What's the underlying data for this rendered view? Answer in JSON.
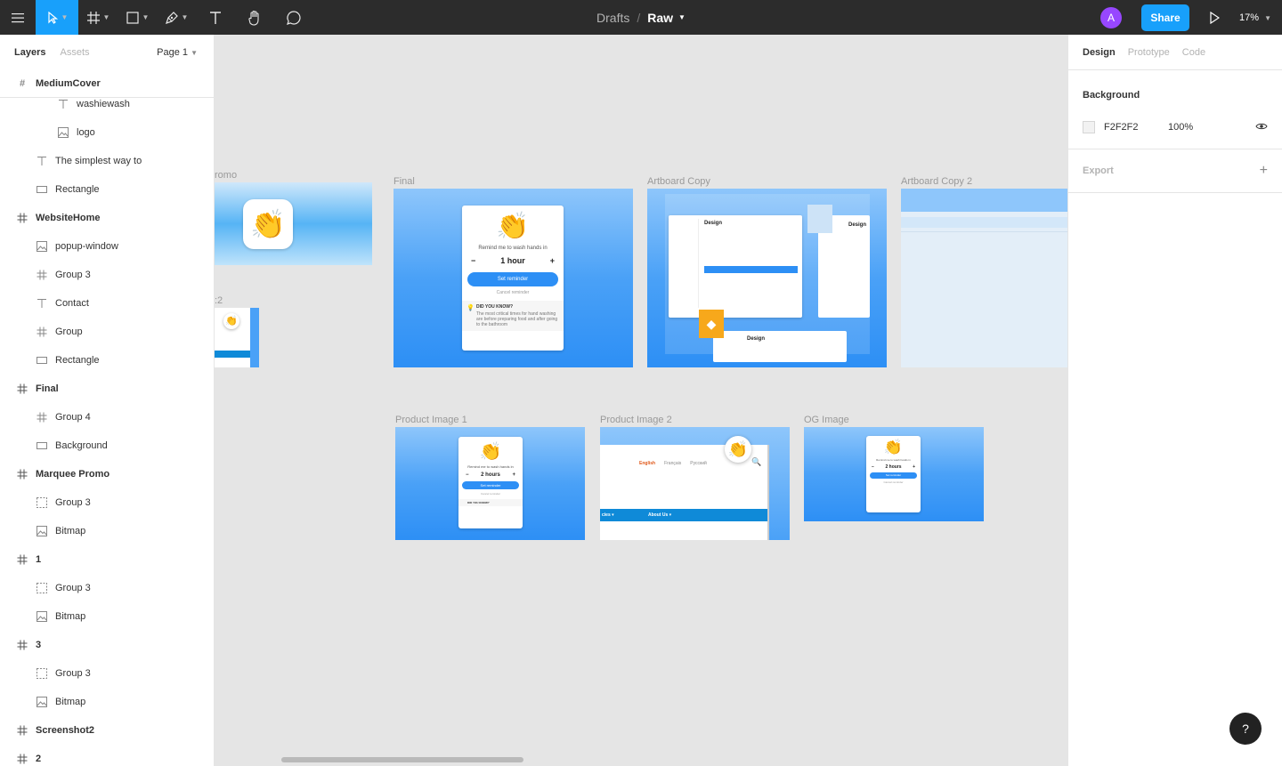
{
  "toolbar": {
    "file_parent": "Drafts",
    "file_name": "Raw",
    "avatar_initial": "A",
    "share_label": "Share",
    "zoom": "17%"
  },
  "left_panel": {
    "tab_layers": "Layers",
    "tab_assets": "Assets",
    "page": "Page 1",
    "sticky_frame": "MediumCover",
    "layers": [
      {
        "name": "washiewash",
        "type": "text",
        "level": "sub"
      },
      {
        "name": "logo",
        "type": "image",
        "level": "sub"
      },
      {
        "name": "The simplest way to",
        "type": "text",
        "level": "child"
      },
      {
        "name": "Rectangle",
        "type": "rect",
        "level": "child"
      },
      {
        "name": "WebsiteHome",
        "type": "frame",
        "level": "frame"
      },
      {
        "name": "popup-window",
        "type": "image",
        "level": "child"
      },
      {
        "name": "Group 3",
        "type": "frame",
        "level": "child"
      },
      {
        "name": "Contact",
        "type": "text",
        "level": "child"
      },
      {
        "name": "Group",
        "type": "frame",
        "level": "child"
      },
      {
        "name": "Rectangle",
        "type": "rect",
        "level": "child"
      },
      {
        "name": "Final",
        "type": "frame",
        "level": "frame"
      },
      {
        "name": "Group 4",
        "type": "frame",
        "level": "child"
      },
      {
        "name": "Background",
        "type": "rect",
        "level": "child"
      },
      {
        "name": "Marquee Promo",
        "type": "frame",
        "level": "frame"
      },
      {
        "name": "Group 3",
        "type": "group",
        "level": "child"
      },
      {
        "name": "Bitmap",
        "type": "image",
        "level": "child"
      },
      {
        "name": "1",
        "type": "frame",
        "level": "frame"
      },
      {
        "name": "Group 3",
        "type": "group",
        "level": "child"
      },
      {
        "name": "Bitmap",
        "type": "image",
        "level": "child"
      },
      {
        "name": "3",
        "type": "frame",
        "level": "frame"
      },
      {
        "name": "Group 3",
        "type": "group",
        "level": "child"
      },
      {
        "name": "Bitmap",
        "type": "image",
        "level": "child"
      },
      {
        "name": "Screenshot2",
        "type": "frame",
        "level": "frame"
      },
      {
        "name": "2",
        "type": "frame",
        "level": "frame"
      }
    ]
  },
  "canvas": {
    "labels": {
      "promo": "romo",
      "final": "Final",
      "artboard_copy": "Artboard Copy",
      "artboard_copy_2": "Artboard Copy 2",
      "partial_2": ":2",
      "product_image_1": "Product Image 1",
      "product_image_2": "Product Image 2",
      "og_image": "OG Image"
    },
    "card": {
      "emoji": "👏",
      "remind": "Remind me to wash hands in",
      "minus": "−",
      "plus": "+",
      "duration_final": "1 hour",
      "duration_product": "2 hours",
      "set_reminder": "Set reminder",
      "cancel": "Cancel reminder",
      "know_title": "DID YOU KNOW?",
      "know_body": "The most critical times for hand washing are before preparing food and after going to the bathroom"
    },
    "artboard_copy": {
      "design_title": "Design",
      "design_title_2": "Design"
    },
    "product2": {
      "nav_items": [
        "English",
        "Français",
        "Русский"
      ],
      "bar_left": "cies ▾",
      "bar_about": "About Us ▾"
    }
  },
  "right_panel": {
    "tab_design": "Design",
    "tab_prototype": "Prototype",
    "tab_code": "Code",
    "background_heading": "Background",
    "bg_hex": "F2F2F2",
    "bg_opacity": "100%",
    "export_label": "Export",
    "help_label": "?"
  },
  "colors": {
    "accent": "#18a0fb",
    "toolbar": "#2c2c2c",
    "avatar": "#9747ff",
    "canvas_bg": "#e5e5e5",
    "frame_blue": "#2d8ff5"
  }
}
